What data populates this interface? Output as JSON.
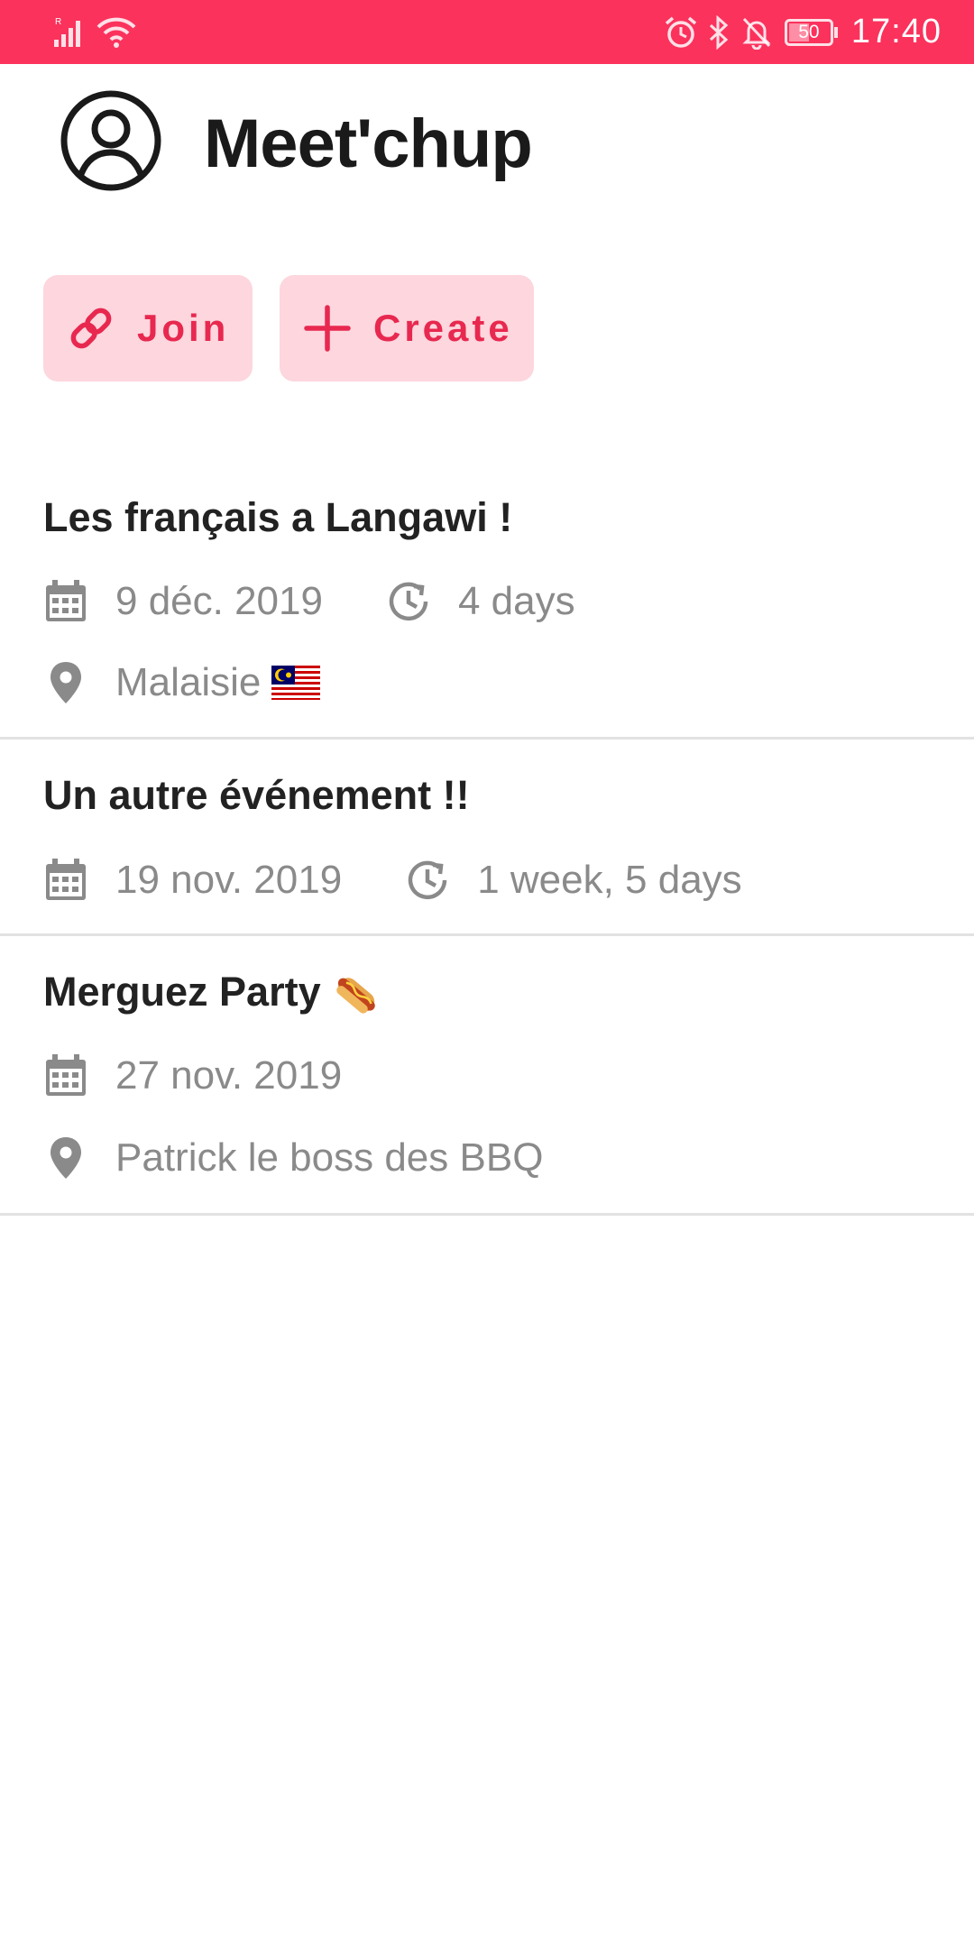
{
  "status_bar": {
    "time": "17:40",
    "battery_level": "50",
    "icons": [
      "signal-icon",
      "wifi-icon",
      "alarm-icon",
      "bluetooth-icon",
      "notifications-off-icon",
      "battery-icon"
    ],
    "color": "#fb325c"
  },
  "header": {
    "title": "Meet'chup",
    "avatar_icon": "account-circle-icon"
  },
  "actions": {
    "join_label": "Join",
    "join_icon": "link-icon",
    "create_label": "Create",
    "create_icon": "plus-icon",
    "button_bg": "#fdd6de",
    "button_fg": "#e8284f"
  },
  "events": [
    {
      "title": "Les français a Langawi !",
      "date": "9 déc. 2019",
      "duration": "4 days",
      "location": "Malaisie",
      "location_emoji": "malaysia-flag"
    },
    {
      "title": "Un autre événement !!",
      "date": "19 nov. 2019",
      "duration": "1 week, 5 days"
    },
    {
      "title": "Merguez Party",
      "title_emoji": "hot-dog",
      "date": "27 nov. 2019",
      "location": "Patrick le boss des BBQ"
    }
  ]
}
